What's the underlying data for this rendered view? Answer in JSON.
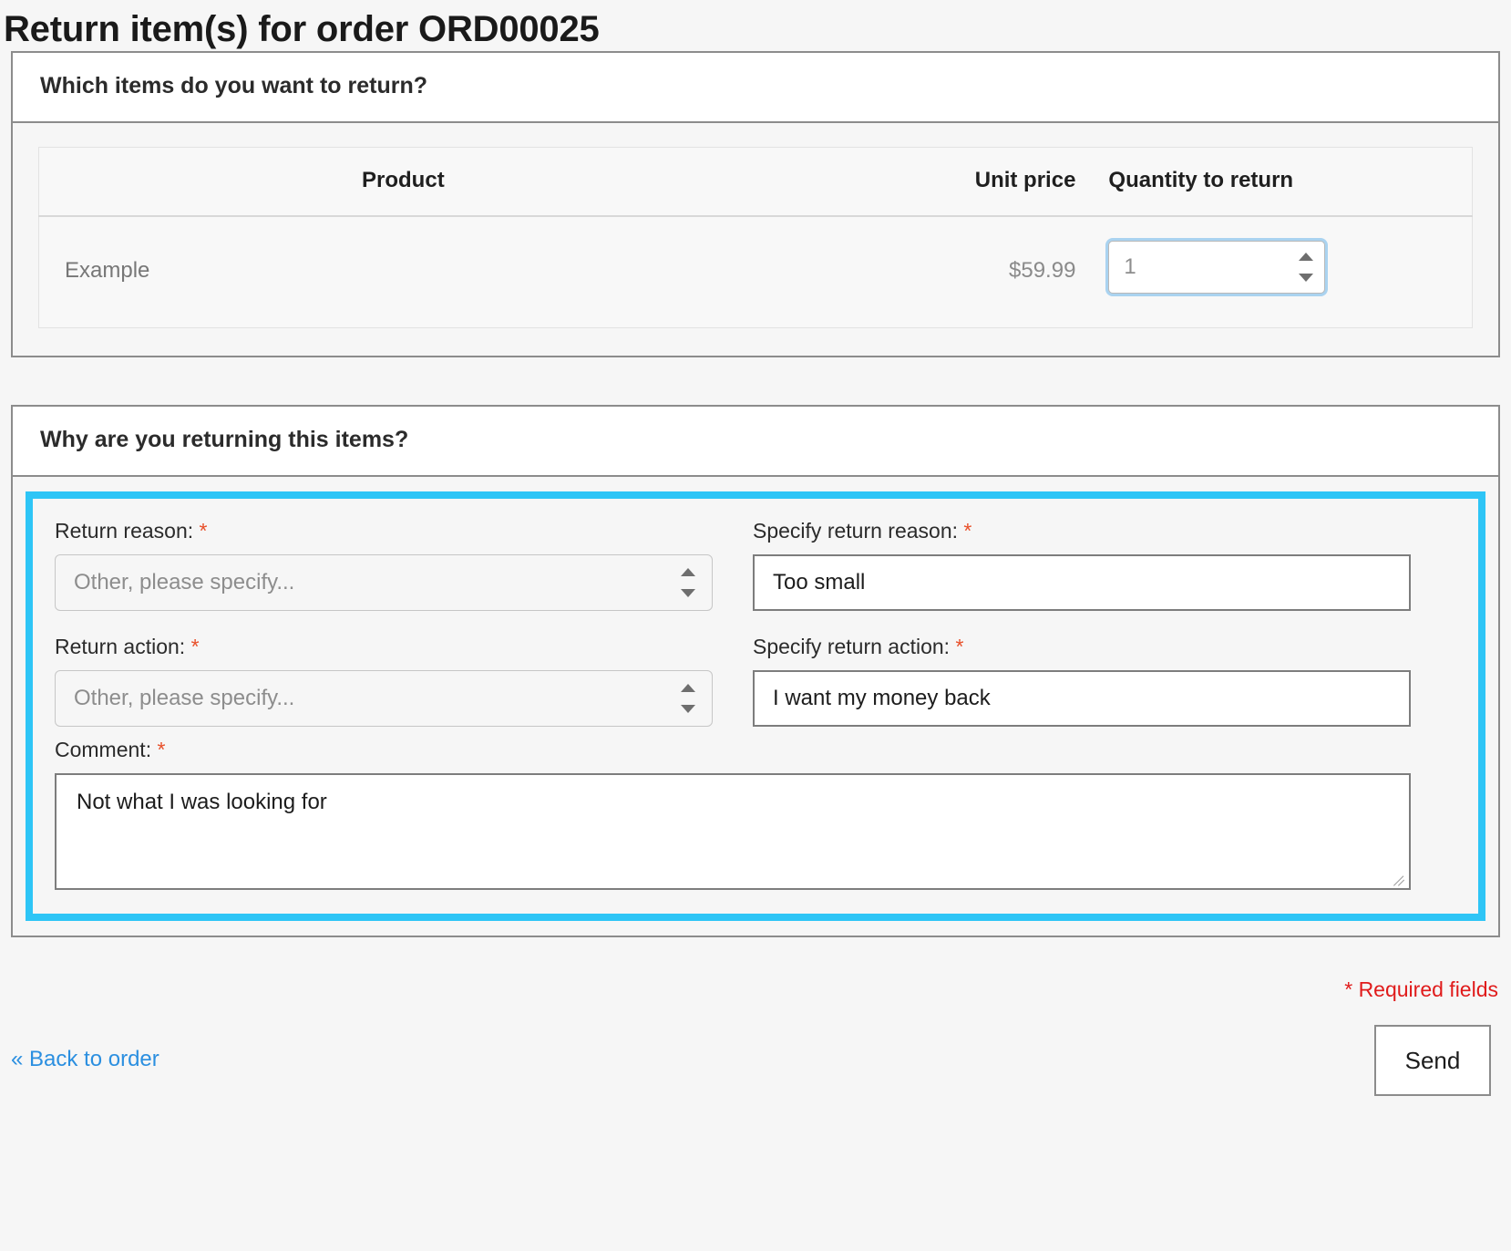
{
  "page": {
    "title": "Return item(s) for order ORD00025"
  },
  "items_panel": {
    "header": "Which items do you want to return?",
    "table": {
      "columns": [
        "Product",
        "Unit price",
        "Quantity to return"
      ],
      "rows": [
        {
          "product": "Example",
          "unit_price": "$59.99",
          "quantity": "1"
        }
      ]
    }
  },
  "reason_panel": {
    "header": "Why are you returning this items?",
    "fields": {
      "return_reason": {
        "label": "Return reason:",
        "required_marker": "*",
        "selected": "Other, please specify..."
      },
      "specify_return_reason": {
        "label": "Specify return reason:",
        "required_marker": "*",
        "value": "Too small",
        "placeholder": ""
      },
      "return_action": {
        "label": "Return action:",
        "required_marker": "*",
        "selected": "Other, please specify..."
      },
      "specify_return_action": {
        "label": "Specify return action:",
        "required_marker": "*",
        "value": "I want my money back",
        "placeholder": ""
      },
      "comment": {
        "label": "Comment:",
        "required_marker": "*",
        "value": "Not what I was looking for"
      }
    }
  },
  "footer": {
    "required_note": "* Required fields",
    "back_link": "« Back to order",
    "send_label": "Send"
  },
  "colors": {
    "focus_highlight": "#2ec5f6",
    "required_star": "#e8502a",
    "required_note": "#e01b1b",
    "link": "#2b8fe0",
    "panel_border": "#8c8c8c",
    "page_bg": "#f6f6f6"
  }
}
